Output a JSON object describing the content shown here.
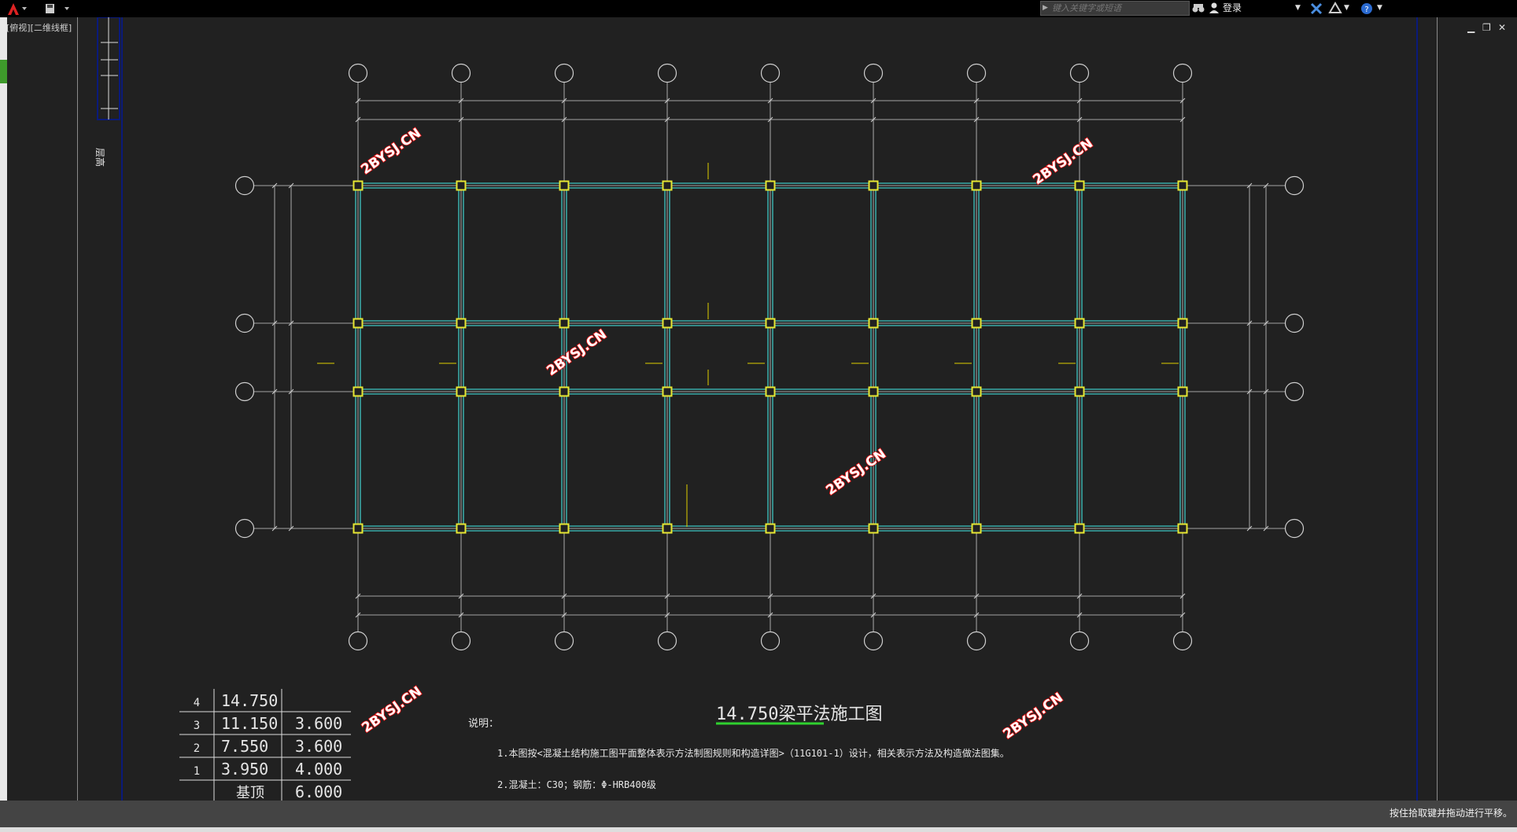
{
  "app": {
    "tab_label": "[俯视][二维线框]",
    "search_placeholder": "键入关键字或短语",
    "login_label": "登录",
    "status_message": "按住拾取键并拖动进行平移。",
    "window_controls": [
      "▁",
      "❐",
      "✕"
    ]
  },
  "drawing": {
    "title": "14.750梁平法施工图",
    "notes_heading": "说明：",
    "notes": [
      "1.本图按<混凝土结构施工图平面整体表示方法制图规则和构造详图>（11G101-1）设计，相关表示方法及构造做法图集。",
      "2.混凝土：C30；钢筋：Φ-HRB400级"
    ],
    "side_label": "层高",
    "watermark": "2BYSJ.CN",
    "level_table": [
      {
        "no": "4",
        "elevation": "14.750",
        "height": ""
      },
      {
        "no": "3",
        "elevation": "11.150",
        "height": "3.600"
      },
      {
        "no": "2",
        "elevation": "7.550",
        "height": "3.600"
      },
      {
        "no": "1",
        "elevation": "3.950",
        "height": "4.000"
      },
      {
        "no": "",
        "elevation": "基顶",
        "height": "6.000"
      }
    ],
    "colors": {
      "beam": "#3fc7c2",
      "column": "#e6e632",
      "axis": "#cfcfcf",
      "underline": "#2fd12f",
      "marker": "#e0d000"
    }
  }
}
